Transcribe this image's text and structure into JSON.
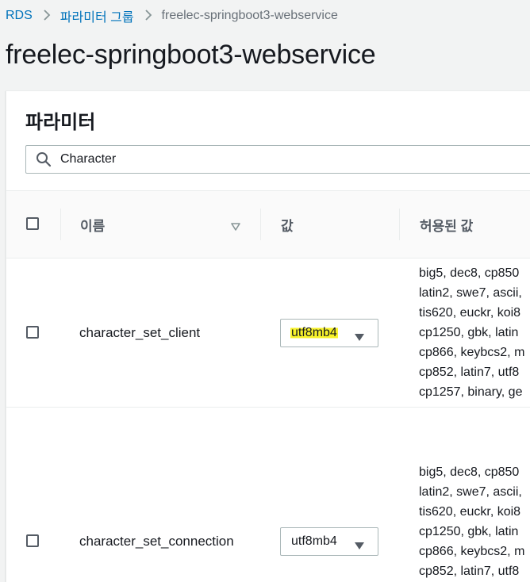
{
  "breadcrumb": {
    "items": [
      "RDS",
      "파라미터 그룹",
      "freelec-springboot3-webservice"
    ]
  },
  "page": {
    "title": "freelec-springboot3-webservice"
  },
  "panel": {
    "title": "파라미터"
  },
  "search": {
    "value": "Character"
  },
  "table": {
    "columns": {
      "name": "이름",
      "value": "값",
      "allowed": "허용된 값"
    },
    "rows": [
      {
        "name": "character_set_client",
        "value": "utf8mb4",
        "allowed": [
          "big5, dec8, cp850",
          "latin2, swe7, ascii,",
          "tis620, euckr, koi8",
          "cp1250, gbk, latin",
          "cp866, keybcs2, m",
          "cp852, latin7, utf8",
          "cp1257, binary, ge"
        ]
      },
      {
        "name": "character_set_connection",
        "value": "utf8mb4",
        "allowed": [
          "big5, dec8, cp850",
          "latin2, swe7, ascii,",
          "tis620, euckr, koi8",
          "cp1250, gbk, latin",
          "cp866, keybcs2, m",
          "cp852, latin7, utf8"
        ]
      }
    ]
  },
  "colors": {
    "link": "#0073bb",
    "highlight": "#f7f22a"
  }
}
